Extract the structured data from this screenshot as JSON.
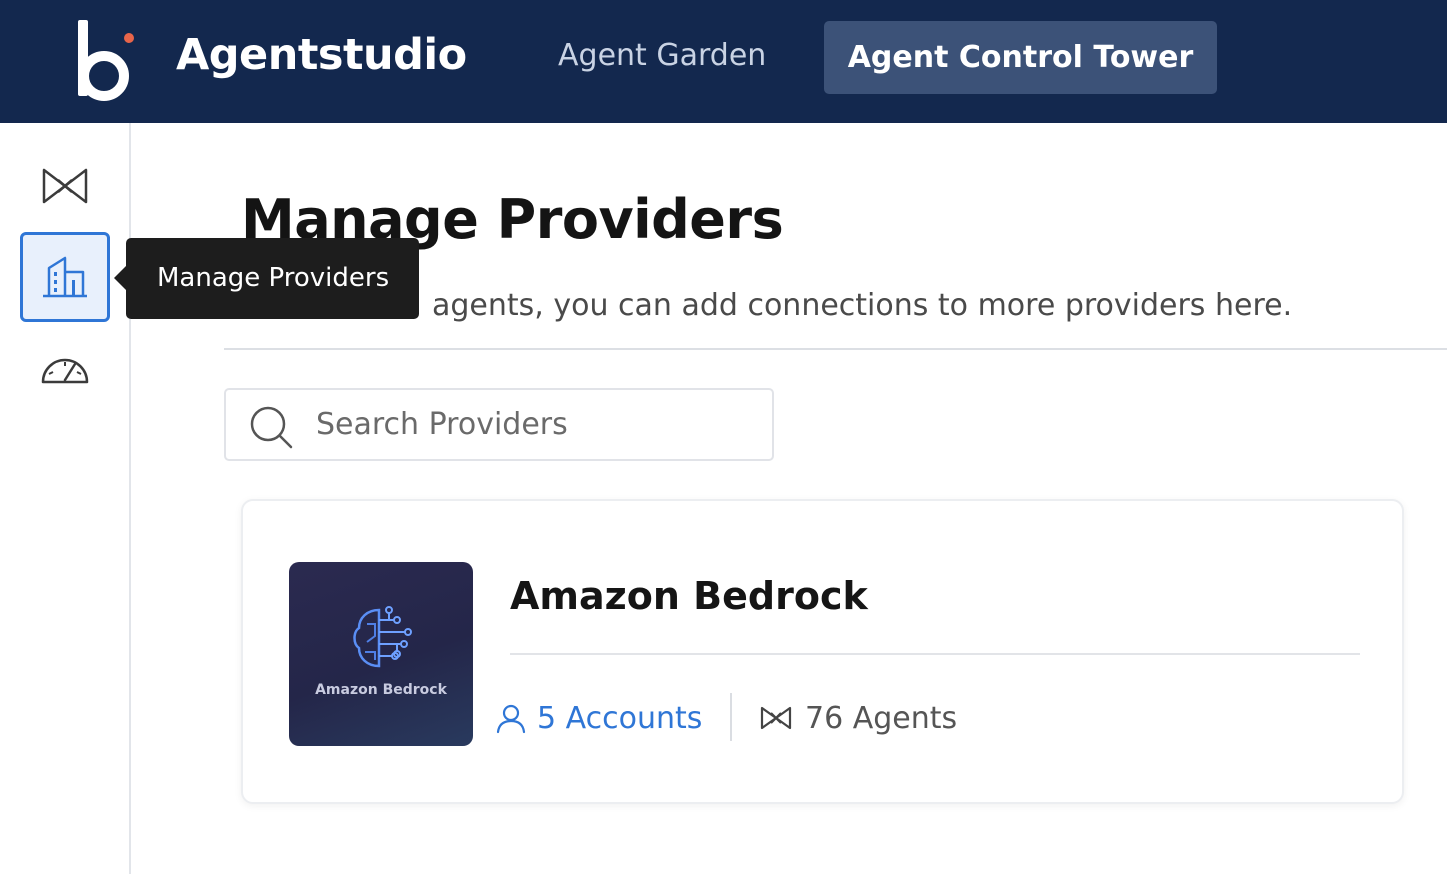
{
  "header": {
    "brand": "Agentstudio",
    "nav": [
      {
        "label": "Agent Garden",
        "active": false
      },
      {
        "label": "Agent Control Tower",
        "active": true
      }
    ]
  },
  "sidebar": {
    "items": [
      {
        "icon": "agents-icon"
      },
      {
        "icon": "building-icon",
        "active": true,
        "tooltip": "Manage Providers"
      },
      {
        "icon": "gauge-icon"
      }
    ]
  },
  "main": {
    "title": "Manage Providers",
    "subtitle": "agents, you can add connections to more providers here.",
    "search_placeholder": "Search Providers"
  },
  "providers": [
    {
      "name": "Amazon Bedrock",
      "logo_text": "Amazon Bedrock",
      "accounts_label": "5 Accounts",
      "agents_label": "76 Agents"
    }
  ],
  "colors": {
    "header_bg": "#13284e",
    "active_nav_bg": "#3c5278",
    "accent": "#2f76d6",
    "logo_dot": "#e8654a"
  }
}
